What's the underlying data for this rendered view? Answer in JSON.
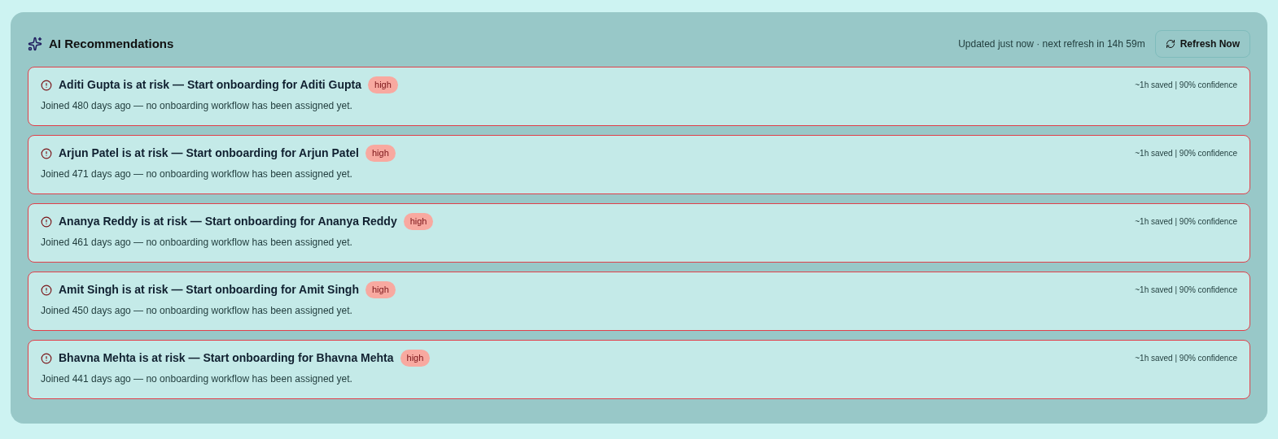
{
  "panel": {
    "title": "AI Recommendations",
    "status": "Updated just now · next refresh in 14h 59m",
    "refresh_button": "Refresh Now"
  },
  "recommendations": [
    {
      "title": "Aditi Gupta is at risk — Start onboarding for Aditi Gupta",
      "priority": "high",
      "description": "Joined 480 days ago — no onboarding workflow has been assigned yet.",
      "meta": "~1h saved | 90% confidence"
    },
    {
      "title": "Arjun Patel is at risk — Start onboarding for Arjun Patel",
      "priority": "high",
      "description": "Joined 471 days ago — no onboarding workflow has been assigned yet.",
      "meta": "~1h saved | 90% confidence"
    },
    {
      "title": "Ananya Reddy is at risk — Start onboarding for Ananya Reddy",
      "priority": "high",
      "description": "Joined 461 days ago — no onboarding workflow has been assigned yet.",
      "meta": "~1h saved | 90% confidence"
    },
    {
      "title": "Amit Singh is at risk — Start onboarding for Amit Singh",
      "priority": "high",
      "description": "Joined 450 days ago — no onboarding workflow has been assigned yet.",
      "meta": "~1h saved | 90% confidence"
    },
    {
      "title": "Bhavna Mehta is at risk — Start onboarding for Bhavna Mehta",
      "priority": "high",
      "description": "Joined 441 days ago — no onboarding workflow has been assigned yet.",
      "meta": "~1h saved | 90% confidence"
    }
  ]
}
